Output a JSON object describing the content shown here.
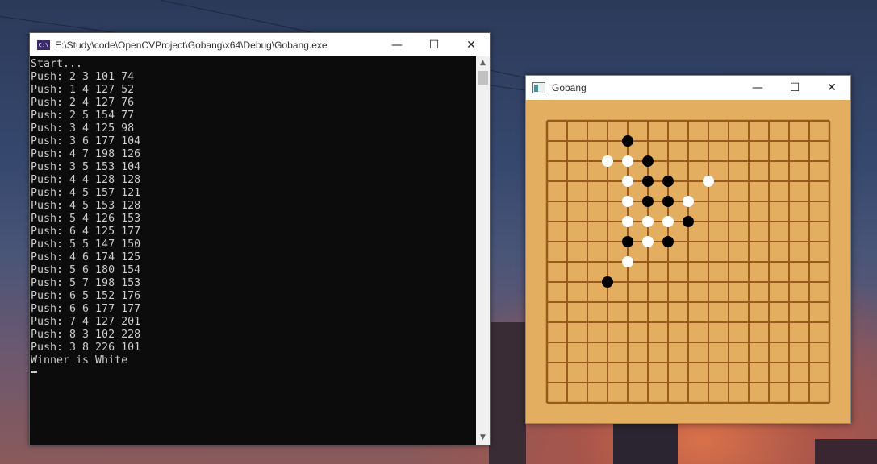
{
  "console": {
    "title": "E:\\Study\\code\\OpenCVProject\\Gobang\\x64\\Debug\\Gobang.exe",
    "icon_label": "C:\\",
    "lines": [
      "Start...",
      "Push: 2 3 101 74",
      "Push: 1 4 127 52",
      "Push: 2 4 127 76",
      "Push: 2 5 154 77",
      "Push: 3 4 125 98",
      "Push: 3 6 177 104",
      "Push: 4 7 198 126",
      "Push: 3 5 153 104",
      "Push: 4 4 128 128",
      "Push: 4 5 157 121",
      "Push: 4 5 153 128",
      "Push: 5 4 126 153",
      "Push: 6 4 125 177",
      "Push: 5 5 147 150",
      "Push: 4 6 174 125",
      "Push: 5 6 180 154",
      "Push: 5 7 198 153",
      "Push: 6 5 152 176",
      "Push: 6 6 177 177",
      "Push: 7 4 127 201",
      "Push: 8 3 102 228",
      "Push: 3 8 226 101",
      "Winner is White"
    ]
  },
  "gobang": {
    "title": "Gobang",
    "board_size": 15,
    "board_color": "#e3ae60",
    "line_color": "#9a5a1e",
    "stones": [
      {
        "row": 1,
        "col": 4,
        "color": "black"
      },
      {
        "row": 2,
        "col": 3,
        "color": "white"
      },
      {
        "row": 2,
        "col": 4,
        "color": "white"
      },
      {
        "row": 2,
        "col": 5,
        "color": "black"
      },
      {
        "row": 3,
        "col": 4,
        "color": "white"
      },
      {
        "row": 3,
        "col": 5,
        "color": "black"
      },
      {
        "row": 3,
        "col": 6,
        "color": "black"
      },
      {
        "row": 3,
        "col": 8,
        "color": "white"
      },
      {
        "row": 4,
        "col": 4,
        "color": "white"
      },
      {
        "row": 4,
        "col": 5,
        "color": "black"
      },
      {
        "row": 4,
        "col": 6,
        "color": "black"
      },
      {
        "row": 4,
        "col": 7,
        "color": "white"
      },
      {
        "row": 5,
        "col": 4,
        "color": "white"
      },
      {
        "row": 5,
        "col": 5,
        "color": "white"
      },
      {
        "row": 5,
        "col": 6,
        "color": "white"
      },
      {
        "row": 5,
        "col": 7,
        "color": "black"
      },
      {
        "row": 6,
        "col": 4,
        "color": "black"
      },
      {
        "row": 6,
        "col": 5,
        "color": "white"
      },
      {
        "row": 6,
        "col": 6,
        "color": "black"
      },
      {
        "row": 7,
        "col": 4,
        "color": "white"
      },
      {
        "row": 8,
        "col": 3,
        "color": "black"
      }
    ]
  },
  "window_controls": {
    "minimize": "—",
    "maximize": "☐",
    "close": "✕"
  }
}
